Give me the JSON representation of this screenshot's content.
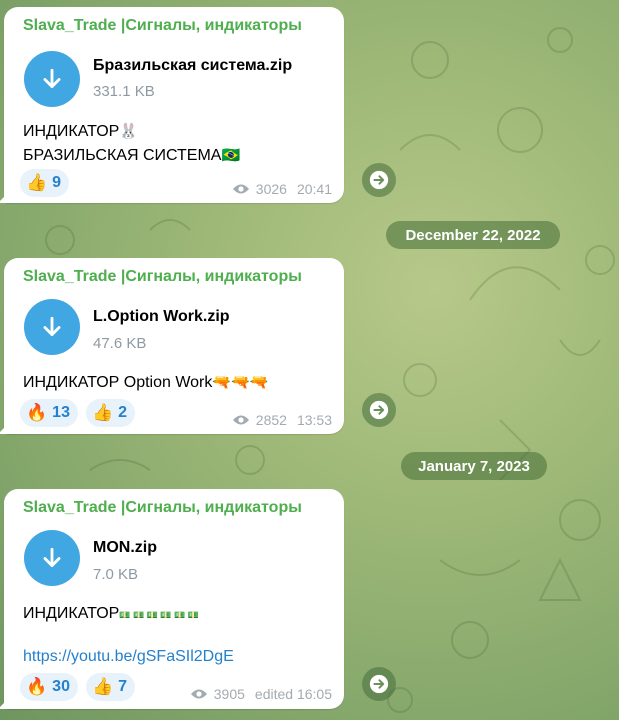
{
  "channel": {
    "name": "Slava_Trade |Сигналы, индикаторы"
  },
  "messages": [
    {
      "sender": "Slava_Trade |Сигналы, индикаторы",
      "file": {
        "name": "Бразильская система.zip",
        "size": "331.1 KB"
      },
      "lines": [
        "ИНДИКАТОР",
        "БРАЗИЛЬСКАЯ СИСТЕМА"
      ],
      "line_emojis": [
        "🐰",
        "🇧🇷"
      ],
      "reactions": [
        {
          "emoji": "👍",
          "count": "9"
        }
      ],
      "views": "3026",
      "time": "20:41"
    },
    {
      "sender": "Slava_Trade |Сигналы, индикаторы",
      "file": {
        "name": "L.Option Work.zip",
        "size": "47.6 KB"
      },
      "lines": [
        "ИНДИКАТОР Option Work"
      ],
      "line_emojis": [
        "🔫🔫🔫"
      ],
      "reactions": [
        {
          "emoji": "🔥",
          "count": "13"
        },
        {
          "emoji": "👍",
          "count": "2"
        }
      ],
      "views": "2852",
      "time": "13:53"
    },
    {
      "sender": "Slava_Trade |Сигналы, индикаторы",
      "file": {
        "name": "MON.zip",
        "size": "7.0 KB"
      },
      "lines": [
        "ИНДИКАТОР"
      ],
      "line_emojis": [
        "💵 💵 💵 💵 💵 💵"
      ],
      "link": "https://youtu.be/gSFaSIl2DgE",
      "reactions": [
        {
          "emoji": "🔥",
          "count": "30"
        },
        {
          "emoji": "👍",
          "count": "7"
        }
      ],
      "views": "3905",
      "time": "edited 16:05"
    }
  ],
  "dates": [
    "December 22, 2022",
    "January 7, 2023"
  ],
  "icons": {
    "download": "download-arrow-icon",
    "views": "eye-icon",
    "share": "share-arrow-icon"
  },
  "colors": {
    "accent": "#40a7e3",
    "sender": "#4fae4e",
    "link": "#2481cc",
    "reaction_bg": "#e7f2fb"
  }
}
